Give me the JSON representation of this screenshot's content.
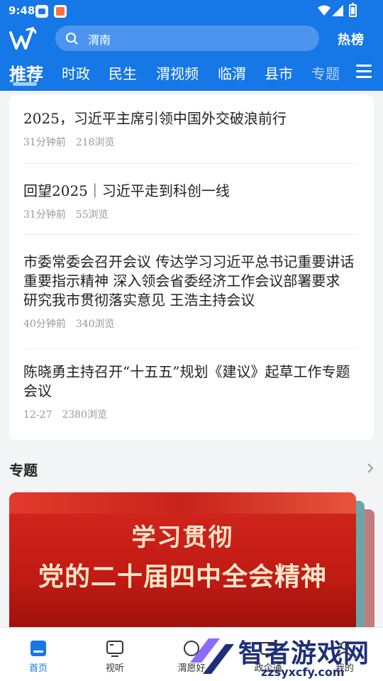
{
  "status_bar": {
    "time": "9:48"
  },
  "header": {
    "logo_icon": "weinan-logo-icon",
    "search_placeholder": "渭南",
    "hot_label": "热榜"
  },
  "tabs": [
    {
      "label": "推荐",
      "active": true
    },
    {
      "label": "时政"
    },
    {
      "label": "民生"
    },
    {
      "label": "渭视频"
    },
    {
      "label": "临渭"
    },
    {
      "label": "县市"
    },
    {
      "label": "专题"
    }
  ],
  "news": [
    {
      "title": "2025，习近平主席引领中国外交破浪前行",
      "time": "31分钟前",
      "views": "218浏览"
    },
    {
      "title": "回望2025｜习近平走到科创一线",
      "time": "31分钟前",
      "views": "55浏览"
    },
    {
      "title": "市委常委会召开会议 传达学习习近平总书记重要讲话重要指示精神 深入领会省委经济工作会议部署要求 研究我市贯彻落实意见 王浩主持会议",
      "time": "40分钟前",
      "views": "340浏览"
    },
    {
      "title": "陈晓勇主持召开“十五五”规划《建议》起草工作专题会议",
      "time": "12-27",
      "views": "2380浏览"
    }
  ],
  "section": {
    "title": "专题",
    "banner_line1": "学习贯彻",
    "banner_line2": "党的二十届四中全会精神"
  },
  "bottom_nav": [
    {
      "label": "首页",
      "icon": "home-icon",
      "active": true
    },
    {
      "label": "视听",
      "icon": "tv-icon"
    },
    {
      "label": "渭愿好",
      "icon": "chat-icon"
    },
    {
      "label": "政企通",
      "icon": "service-icon"
    },
    {
      "label": "我的",
      "icon": "user-icon"
    }
  ],
  "watermark": {
    "title": "智者游戏网",
    "site": "zzsyxcfy.com"
  },
  "colors": {
    "brand": "#1677e6",
    "banner": "#c01b14"
  }
}
